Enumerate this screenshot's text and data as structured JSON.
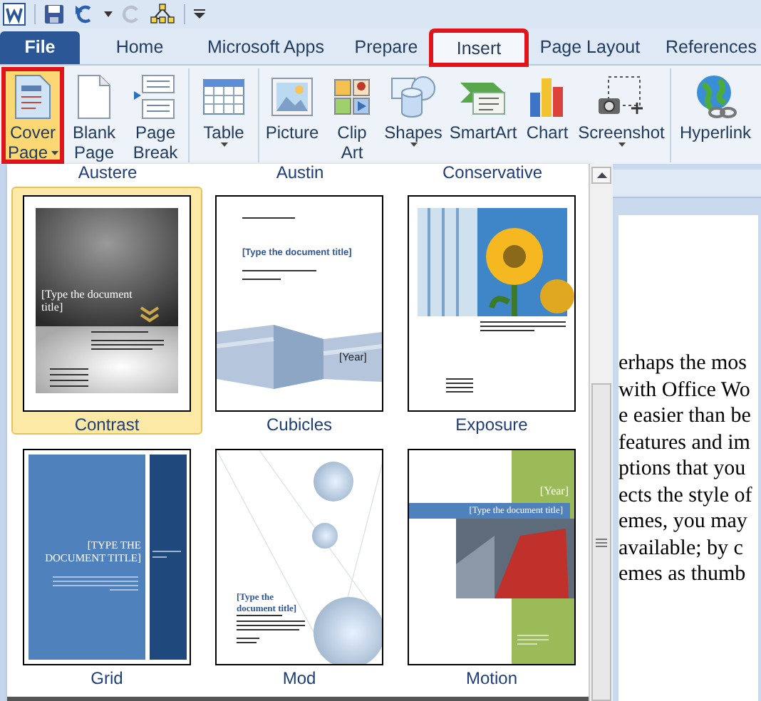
{
  "tabs": [
    {
      "label": "File",
      "kind": "file",
      "selected": false,
      "annotated": false
    },
    {
      "label": "Home",
      "kind": "tab",
      "selected": false,
      "annotated": false
    },
    {
      "label": "Microsoft Apps",
      "kind": "tab",
      "selected": false,
      "annotated": false
    },
    {
      "label": "Prepare",
      "kind": "tab",
      "selected": false,
      "annotated": false
    },
    {
      "label": "Insert",
      "kind": "tab",
      "selected": true,
      "annotated": true
    },
    {
      "label": "Page Layout",
      "kind": "tab",
      "selected": false,
      "annotated": false
    },
    {
      "label": "References",
      "kind": "tab",
      "selected": false,
      "annotated": false
    }
  ],
  "ribbon": {
    "groups": [
      {
        "buttons": [
          {
            "label": "Cover",
            "label2": "Page",
            "kind": "cover",
            "dropdown": true,
            "selected": true,
            "annotated": true
          },
          {
            "label": "Blank",
            "label2": "Page",
            "kind": "blank",
            "dropdown": false,
            "selected": false,
            "annotated": false
          },
          {
            "label": "Page",
            "label2": "Break",
            "kind": "break",
            "dropdown": false,
            "selected": false,
            "annotated": false
          }
        ]
      },
      {
        "buttons": [
          {
            "label": "Table",
            "kind": "table",
            "dropdown": true,
            "selected": false,
            "annotated": false
          }
        ]
      },
      {
        "buttons": [
          {
            "label": "Picture",
            "kind": "picture",
            "dropdown": false,
            "selected": false,
            "annotated": false
          },
          {
            "label": "Clip",
            "label2": "Art",
            "kind": "clipart",
            "dropdown": false,
            "selected": false,
            "annotated": false
          },
          {
            "label": "Shapes",
            "kind": "shapes",
            "dropdown": true,
            "selected": false,
            "annotated": false
          },
          {
            "label": "SmartArt",
            "kind": "smartart",
            "dropdown": false,
            "selected": false,
            "annotated": false
          },
          {
            "label": "Chart",
            "kind": "chart",
            "dropdown": false,
            "selected": false,
            "annotated": false
          },
          {
            "label": "Screenshot",
            "kind": "screenshot",
            "dropdown": true,
            "selected": false,
            "annotated": false
          }
        ]
      },
      {
        "buttons": [
          {
            "label": "Hyperlink",
            "kind": "hyperlink",
            "dropdown": false,
            "selected": false,
            "annotated": false
          }
        ]
      }
    ]
  },
  "gallery": {
    "header_labels": [
      "Austere",
      "Austin",
      "Conservative"
    ],
    "items": [
      {
        "label": "Contrast",
        "kind": "contrast",
        "selected": true,
        "title": "[Type the document title]"
      },
      {
        "label": "Cubicles",
        "kind": "cubicles",
        "selected": false,
        "title": "[Type the document title]",
        "year": "[Year]"
      },
      {
        "label": "Exposure",
        "kind": "exposure",
        "selected": false
      },
      {
        "label": "Grid",
        "kind": "grid",
        "selected": false,
        "title": "[TYPE THE DOCUMENT TITLE]"
      },
      {
        "label": "Mod",
        "kind": "mod",
        "selected": false,
        "title": "[Type the document title]"
      },
      {
        "label": "Motion",
        "kind": "motion",
        "selected": false,
        "title": "[Type the document title]",
        "year": "[Year]"
      }
    ]
  },
  "document": {
    "lines": [
      "erhaps the mos",
      "with Office Wo",
      "e easier  than be",
      "features and im",
      "ptions that you",
      "ects the style of",
      "emes, you may",
      "available; by c",
      "emes as thumb"
    ]
  }
}
